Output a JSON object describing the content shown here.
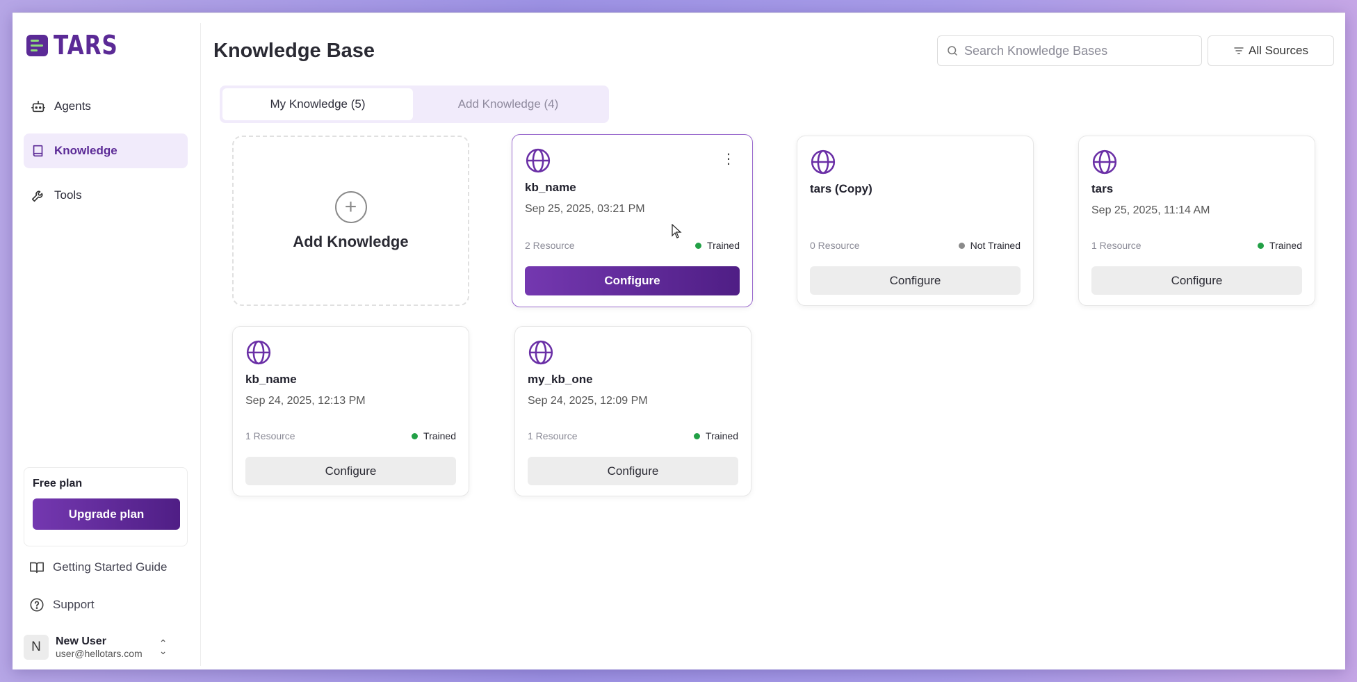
{
  "app": {
    "logo_text": "TARS"
  },
  "sidebar": {
    "items": [
      {
        "label": "Agents",
        "icon": "robot-icon"
      },
      {
        "label": "Knowledge",
        "icon": "book-icon",
        "active": true
      },
      {
        "label": "Tools",
        "icon": "wrench-icon"
      }
    ],
    "plan": {
      "title": "Free plan",
      "upgrade_label": "Upgrade plan"
    },
    "links": [
      {
        "label": "Getting Started Guide",
        "icon": "open-book-icon"
      },
      {
        "label": "Support",
        "icon": "help-circle-icon"
      }
    ],
    "user": {
      "initial": "N",
      "name": "New User",
      "email": "user@hellotars.com"
    }
  },
  "header": {
    "title": "Knowledge Base",
    "search_placeholder": "Search Knowledge Bases",
    "filter_label": "All Sources"
  },
  "tabs": [
    {
      "label": "My Knowledge (5)",
      "active": true
    },
    {
      "label": "Add Knowledge (4)",
      "active": false
    }
  ],
  "add_card": {
    "label": "Add Knowledge"
  },
  "cards": [
    {
      "name": "kb_name",
      "date": "Sep 25, 2025, 03:21 PM",
      "resources": "2 Resource",
      "status": "Trained",
      "configure": "Configure"
    },
    {
      "name": "tars (Copy)",
      "date": "",
      "resources": "0 Resource",
      "status": "Not Trained",
      "configure": "Configure"
    },
    {
      "name": "tars",
      "date": "Sep 25, 2025, 11:14 AM",
      "resources": "1 Resource",
      "status": "Trained",
      "configure": "Configure"
    },
    {
      "name": "kb_name",
      "date": "Sep 24, 2025, 12:13 PM",
      "resources": "1 Resource",
      "status": "Trained",
      "configure": "Configure"
    },
    {
      "name": "my_kb_one",
      "date": "Sep 24, 2025, 12:09 PM",
      "resources": "1 Resource",
      "status": "Trained",
      "configure": "Configure"
    }
  ],
  "colors": {
    "brand": "#5b2a96",
    "trained": "#22a046",
    "not_trained": "#8a8a8a"
  }
}
